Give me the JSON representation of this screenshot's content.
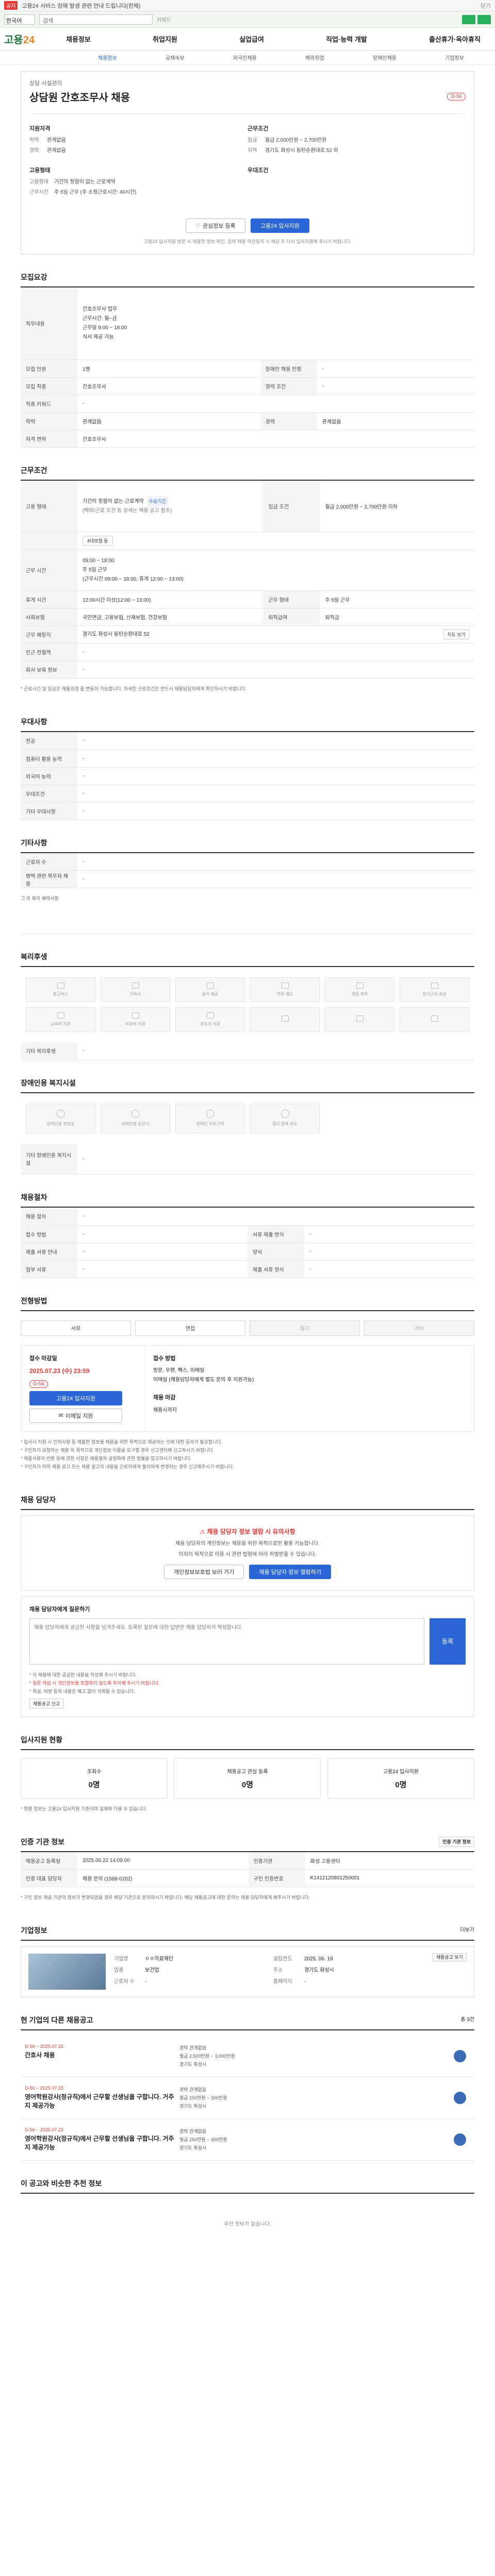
{
  "notice": {
    "badge": "공지",
    "text": "고용24 서비스 장애 발생 관련 안내 드립니다(전체)",
    "close": "닫기"
  },
  "search": {
    "lang": "한국어",
    "placeholder": "검색",
    "hint": "키워드"
  },
  "header": {
    "logo_main": "고용",
    "logo_num": "24",
    "menu": [
      "채용정보",
      "취업지원",
      "실업급여",
      "직업·능력 개발",
      "출산휴가·육아휴직"
    ]
  },
  "lnb": [
    "채용정보",
    "공채속보",
    "외국인채용",
    "해외취업",
    "장애인채용",
    "기업정보"
  ],
  "job": {
    "company": "상담 시설관리",
    "title": "상담원 간호조무사 채용",
    "dday": "D-56",
    "summary_left_title": "지원자격",
    "summary_right_title": "근무조건",
    "edu_label": "학력",
    "edu": "관계없음",
    "career_label": "경력",
    "career": "관계없음",
    "pay_label": "임금",
    "pay": "월급 2,000만원 ~ 2,700만원",
    "place_label": "지역",
    "place": "경기도 화성시 동탄순환대로 52 외",
    "type_title": "고용형태",
    "type_label": "고용형태",
    "type": "기간의 정함이 없는 근로계약",
    "time_label": "근무시간",
    "time": "주 5일 근무 (주 소정근로시간: 40시간)",
    "pref_title": "우대조건",
    "btn_save": "관심정보 등록",
    "btn_apply": "고용24 입사지원",
    "head_note": "고용24 입사지원 방문 시 채용한 정보 확인, 입력 채용 약관동의 시 해당 후 다시 입사지원해 주시기 바랍니다."
  },
  "recruit": {
    "title": "모집요강",
    "duty_label": "직무내용",
    "duty_lines": [
      "간호조무사 업무",
      "근무시간: 월~금",
      "근무일 9:00 ~ 18:00",
      "식사 제공 가능"
    ],
    "rows": [
      {
        "k": "모집 인원",
        "v": "1명",
        "k2": "장애인 채용 인정",
        "v2": "-"
      },
      {
        "k": "모집 직종",
        "v": "간호조무사",
        "k2": "경력 조건",
        "v2": "-"
      },
      {
        "k": "직종 키워드",
        "v": "-",
        "k2": "",
        "v2": ""
      },
      {
        "k": "학력",
        "v": "관계없음",
        "k2": "경력",
        "v2": "관계없음"
      },
      {
        "k": "자격 면허",
        "v": "간호조무사",
        "k2": "",
        "v2": ""
      }
    ]
  },
  "conditions": {
    "title": "근무조건",
    "emp_type_label": "고용 형태",
    "emp_type": "기간의 정함이 없는 근로계약",
    "emp_tag": "수습기간",
    "emp_sub": "(해외/근로 조건 등 상세는 채용 공고 참조)",
    "pay_label": "임금 조건",
    "pay": "월급 2,000만원 ~ 2,700만원 이하",
    "insurance": "4대보험 등",
    "work_label": "근무 시간",
    "work_line1": "09:00 ~ 18:00",
    "work_line2": "주 5일 근무",
    "work_line3": "(근무시간 09:00 ~ 18:00, 휴게 12:00 ~ 13:00)",
    "rows": [
      {
        "k": "휴게 시간",
        "v": "12:00시간 이상(12:00 ~ 13:00)",
        "k2": "근무 형태",
        "v2": "주 5일 근무"
      },
      {
        "k": "사회보험",
        "v": "국민연금, 고용보험, 산재보험, 건강보험",
        "k2": "퇴직급여",
        "v2": "퇴직금"
      },
      {
        "k": "근무 예정지",
        "v": "경기도 화성시 동탄순환대로 52",
        "k2": "",
        "v2": ""
      }
    ],
    "map_btn": "지도 보기",
    "extra": [
      {
        "k": "인근 전철역",
        "v": "-"
      },
      {
        "k": "회사 보육 정보",
        "v": "-"
      }
    ],
    "note": "* 근로시간 및 임금은 채용과정 중 변동이 가능합니다. 자세한 근로조건은 반드시 채용담당자에게 확인하시기 바랍니다."
  },
  "preferred": {
    "title": "우대사항",
    "rows": [
      {
        "k": "전공",
        "v": "-"
      },
      {
        "k": "컴퓨터 활용 능력",
        "v": "-"
      },
      {
        "k": "외국어 능력",
        "v": "-"
      },
      {
        "k": "우대조건",
        "v": "-"
      },
      {
        "k": "기타 우대사항",
        "v": "-"
      }
    ]
  },
  "etc": {
    "title": "기타사항",
    "rows": [
      {
        "k": "근로자 수",
        "v": "-"
      },
      {
        "k": "병역 관련 복무자 채용",
        "v": "-"
      }
    ],
    "note": "그 외 복리 혜택사항"
  },
  "welfare": {
    "title": "복리후생",
    "items": [
      "통근버스",
      "기숙사",
      "중식 제공",
      "연차 제도",
      "생일 축하",
      "장기근속 포상",
      "교육비 지원",
      "의료비 지원",
      "경조사 지원",
      "",
      "",
      ""
    ],
    "etc_label": "기타 복리후생",
    "etc_value": "-"
  },
  "disability": {
    "title": "장애인용 복지시설",
    "items": [
      "장애인용 화장실",
      "장애인용 승강기",
      "장애인 주차구역",
      "점자 블록 유도",
      "",
      ""
    ],
    "etc_label": "기타 장애인용 복지시설",
    "etc_value": "-"
  },
  "process": {
    "title": "채용절차",
    "rows": [
      {
        "k": "채용 절차",
        "v": "-",
        "k2": "",
        "v2": ""
      },
      {
        "k": "접수 방법",
        "v": "-",
        "k2": "서류 제출 방식",
        "v2": "-"
      },
      {
        "k": "제출 서류 안내",
        "v": "-",
        "k2": "양식",
        "v2": "-"
      },
      {
        "k": "첨부 서류",
        "v": "-",
        "k2": "제출 서류 양식",
        "v2": "-"
      }
    ]
  },
  "apply": {
    "title": "전형방법",
    "methods": [
      "서류",
      "면접",
      "필기",
      "기타"
    ],
    "period_label": "접수 마감일",
    "period": "2025.07.23 (수) 23:59",
    "dday": "D-56",
    "btn_apply": "고용24 입사지원",
    "btn_email": "이메일 지원",
    "right_title": "접수 방법",
    "right_lines": [
      "방문, 우편, 팩스, 이메일",
      "이메일 (채용담당자에게 별도 문의 후 지원가능)"
    ],
    "right_title2": "채용 마감",
    "right_val2": "채용시까지"
  },
  "apply_notes": [
    "* 입사시 지원 시 인적사항 등 제출한 정보를 채용을 위한 목적으로 제공하는 것에 대한 동의가 필요합니다.",
    "* 구인자가 요청하는 채용 외 목적으로 개인정보 이용을 요구할 경우 신고센터에 신고하시기 바랍니다.",
    "* 채용서류의 반환 등에 관한 사항은 채용절차 공정화에 관한 법률을 참고하시기 바랍니다.",
    "* 구인자가 허위 채용 광고 또는 채용 광고의 내용을 근로자에게 불리하게 변경하는 경우 신고해주시기 바랍니다."
  ],
  "contact": {
    "title": "채용 담당자",
    "alert": "채용 담당자 정보 열람 시 유의사항",
    "desc1": "채용 담당자의 개인정보는 채용을 위한 목적으로만 활용 가능합니다.",
    "desc2": "이외의 목적으로 이용 시 관련 법령에 따라 처벌받을 수 있습니다.",
    "btn1": "개인정보보호법 보러 가기",
    "btn2": "채용 담당자 정보 열람하기"
  },
  "inquiry": {
    "title": "채용 담당자에게 질문하기",
    "placeholder": "채용 담당자에게 궁금한 사항을 남겨주세요. 등록된 질문에 대한 답변은 채용 담당자가 작성합니다.",
    "submit": "등록",
    "notes": [
      "* 이 채용에 대한 궁금한 내용을 작성해 주시기 바랍니다.",
      "* 질문 작성 시 개인정보를 포함하지 않도록 주의해 주시기 바랍니다.",
      "* 욕설, 비방 등의 내용은 예고 없이 삭제될 수 있습니다."
    ],
    "report": "채용공고 신고"
  },
  "status": {
    "title": "입사지원 현황",
    "items": [
      {
        "label": "조회수",
        "value": "0명"
      },
      {
        "label": "채용공고 관심 등록",
        "value": "0명"
      },
      {
        "label": "고용24 입사지원",
        "value": "0명"
      }
    ],
    "note": "* 현황 정보는 고용24 입사지원 기준이며 실제와 다를 수 있습니다."
  },
  "agency": {
    "title": "인증 기관 정보",
    "btn": "인증 기관 정보",
    "rows": [
      {
        "k": "채용공고 등록일",
        "v": "2025.06.22 14:09:00",
        "k2": "인증기관",
        "v2": "화성 고용센터"
      },
      {
        "k": "인증 대표 담당자",
        "v": "채용 문의 (1588-0202)",
        "k2": "구인 인증번호",
        "v2": "K1412120801250001"
      }
    ],
    "note": "* 구인 정보 제공 기관의 정보가 변경되었을 경우 해당 기관으로 문의하시기 바랍니다. 해당 채용공고에 대한 문의는 채용 담당자에게 해주시기 바랍니다."
  },
  "company": {
    "title": "기업정보",
    "more": "더보기",
    "name_label": "기업명",
    "name": "ㅇㅇ의료재단",
    "type_label": "업종",
    "type": "보건업",
    "emp_label": "근로자 수",
    "emp": "-",
    "found_label": "설립연도",
    "found": "2025. 06. 19",
    "addr_label": "주소",
    "addr": "경기도 화성시",
    "homepage_label": "홈페이지",
    "homepage": "-",
    "btn": "채용공고 보기"
  },
  "others": {
    "title": "현 기업의 다른 채용공고",
    "count": "총 3건",
    "items": [
      {
        "dday": "D-56 ~ 2025.07.23",
        "name": "간호사 채용",
        "line1": "경력 관계없음",
        "line2": "월급 2,500만원 ~ 3,000만원",
        "line3": "경기도 화성시"
      },
      {
        "dday": "D-56 ~ 2025.07.23",
        "name": "영어학원강사(정규직)에서 근무할 선생님을 구합니다. 거주지 제공가능",
        "line1": "경력 관계없음",
        "line2": "월급 250만원 ~ 300만원",
        "line3": "경기도 화성시"
      },
      {
        "dday": "D-56 ~ 2025.07.23",
        "name": "영어학원강사(정규직)에서 근무할 선생님을 구합니다. 거주지 제공가능",
        "line1": "경력 관계없음",
        "line2": "월급 250만원 ~ 300만원",
        "line3": "경기도 화성시"
      }
    ]
  },
  "recommend": {
    "title": "이 공고와 비슷한 추천 정보",
    "empty": "추천 정보가 없습니다."
  }
}
